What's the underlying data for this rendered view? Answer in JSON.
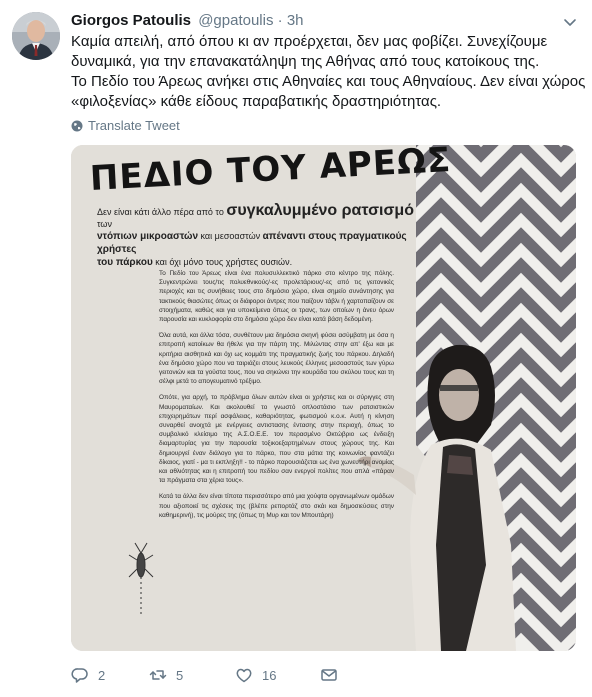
{
  "tweet": {
    "author_name": "Giorgos Patoulis",
    "handle": "@gpatoulis",
    "separator": "·",
    "time": "3h",
    "text_lines": [
      "Καμία απειλή, από όπου κι αν προέρχεται, δεν μας φοβίζει. Συνεχίζουμε",
      "δυναμικά, για την επανακατάληψη της Αθήνας από τους κατοίκους της.",
      "Το Πεδίο του Άρεως ανήκει στις Αθηναίες και τους Αθηναίους. Δεν είναι χώρος",
      "«φιλοξενίας» κάθε είδους παραβατικής δραστηριότητας."
    ],
    "translate_label": "Translate Tweet"
  },
  "poster": {
    "title": "ΠΕΔΙΟ ΤΟΥ ΑΡΕΩΣ",
    "subtitle_small_1": "Δεν είναι κάτι άλλο πέρα από το",
    "subtitle_big": "συγκαλυμμένο ρατσισμό",
    "subtitle_small_2": "των",
    "subtitle_mid_1": "ντόπιων μικροαστών",
    "subtitle_small_3": "και μεσοαστών",
    "subtitle_mid_2": "απέναντι στους πραγματικούς χρήστες",
    "subtitle_mid_3": "του πάρκου",
    "subtitle_small_4": "και όχι μόνο τους χρήστες ουσιών.",
    "paragraphs": [
      "Το Πεδίο του Άρεως είναι ένα πολυσυλλεκτικό πάρκο στο κέντρο της πόλης. Συγκεντρώνει τους/τις πολυεθνικούς/-ες προλετάριους/-ες από τις γειτονικές περιοχές και τις συνήθειες τους στο δημόσιο χώρο, είναι σημείο συνάντησης για τακτικούς θιασώτες όπως οι διάφοροι άντρες που παίζουν τάβλι ή χαρτοπαίζουν σε στοιχήματα, καθώς και για υποκείμενα όπως οι τρανς, των οποίων η άνευ όρων παρουσία και κυκλοφορία στο δημόσιο χώρο δεν είναι κατά βάση δεδομένη.",
      "Όλα αυτά, και άλλα τόσα, συνθέτουν μια δημόσια σκηνή φύσει ασύμβατη με όσα η επιτροπή κατοίκων θα ήθελε για την πάρτη της. Μιλώντας στην απ’ έξω και με κριτήρια αισθητικά και όχι ως κομμάτι της πραγματικής ζωής του πάρκου. Δηλαδή ένα δημόσιο χώρο που να ταιριάζει στους λευκούς έλληνες μεσοαστούς των γύρω γειτονιών και τα γούστα τους, που να σηκώνει την κουράδα του σκύλου τους και τη σέλφι μετά το απογευματινό τρέξιμο.",
      "Οπότε, για αρχή, το πρόβλημα όλων αυτών είναι οι χρήστες και οι σύριγγες στη Μαυροματαίων. Και ακολουθεί το γνωστό οπλοστάσιο των ρατσιστικών επιχειρημάτων περί ασφάλειας, καθαριότητας, φωτισμού κ.ο.κ. Αυτή η κίνηση συναρθεί ανοιχτά με ενέργειες αντιστασης έντασης στην περιοχή, όπως το συμβολικό κλείσιμο της Α.Σ.Ο.Ε.Ε. τον περασμένο Οκτώβριο ως ένδειξη διαμαρτυρίας για την παρουσία τοξικοεξαρτημένων στους χώρους της. Και δημιουργεί έναν διάλογο για το πάρκο, που στα μάτια της κοινωνίας φαντάζει δίκαιος, γιατί - μα τι εκπληξη!! - το πάρκο παρουσιάζεται ως ένα χωνευτήρι ανομίας και αθλιότητας και η επιτροπή του πεδίου σαν ενεργοί πολίτες που απλά «πάραν τα πράγματα στα χέρια τους».",
      "Κατά τα άλλα δεν είναι τίποτα περισσότερο από μια χούφτα οργανωμένων ομάδων που αξιοποιεί τις σχέσεις της (βλέπε ρεπορτάζ στο σκάι και δημοσιεύσεις στην καθημερινή), τις μούρες της (όπως τη Μυρ και τον Μπουτάρη)"
    ]
  },
  "actions": {
    "reply_count": "2",
    "retweet_count": "5",
    "like_count": "16"
  },
  "colors": {
    "text": "#14171a",
    "secondary": "#657786",
    "background": "#ffffff"
  },
  "icons": [
    "caret-down-icon",
    "globe-icon",
    "reply-icon",
    "retweet-icon",
    "heart-icon",
    "message-icon"
  ]
}
